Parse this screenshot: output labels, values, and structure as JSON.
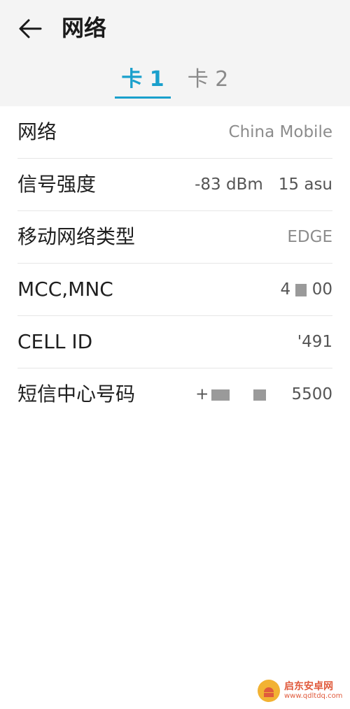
{
  "header": {
    "title": "网络",
    "back_icon": "arrow-left-icon"
  },
  "tabs": [
    {
      "label": "卡 1",
      "selected": true
    },
    {
      "label": "卡 2",
      "selected": false
    }
  ],
  "colors": {
    "accent": "#1aa0cc",
    "header_bg": "#f4f4f4",
    "label": "#1f1f1f",
    "value": "#8c8c8c"
  },
  "info_rows": [
    {
      "label": "网络",
      "value": "China Mobile"
    },
    {
      "label": "信号强度",
      "value": "-83 dBm",
      "value2": "15 asu"
    },
    {
      "label": "移动网络类型",
      "value": "EDGE"
    },
    {
      "label": "MCC,MNC",
      "value_start": "4",
      "value_end": "00"
    },
    {
      "label": "CELL ID",
      "value": "'491"
    },
    {
      "label": "短信中心号码",
      "value_start": "+",
      "value_end": "5500"
    }
  ],
  "watermark": {
    "name": "启东安卓网",
    "url": "www.qdltdq.com"
  }
}
